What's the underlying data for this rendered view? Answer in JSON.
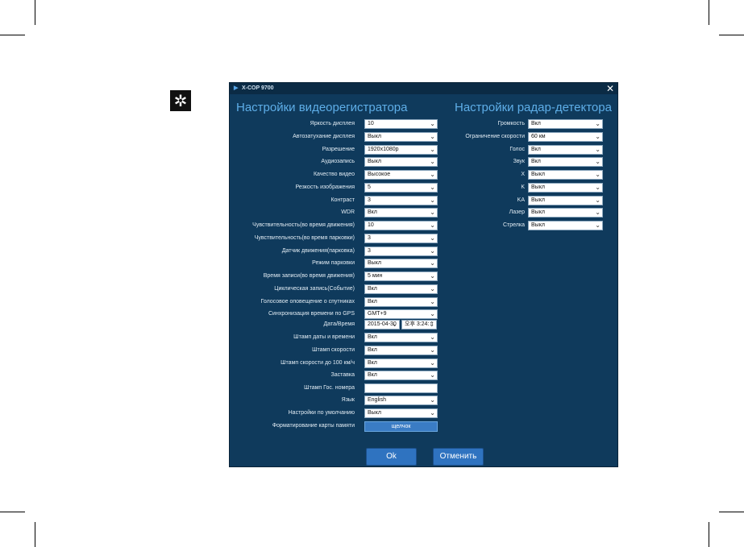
{
  "window": {
    "title": "X-COP 9700"
  },
  "video_section": {
    "heading": "Настройки видеорегистратора",
    "rows": [
      {
        "label": "Яркость дисплея",
        "value": "10"
      },
      {
        "label": "Автозатухание дисплея",
        "value": "Выкл"
      },
      {
        "label": "Разрешение",
        "value": "1920x1080p"
      },
      {
        "label": "Аудиозапись",
        "value": "Выкл"
      },
      {
        "label": "Качество видео",
        "value": "Высокое"
      },
      {
        "label": "Резкость изображения",
        "value": "5"
      },
      {
        "label": "Контраст",
        "value": "3"
      },
      {
        "label": "WDR",
        "value": "Вкл"
      },
      {
        "label": "Чувствительность(во время движения)",
        "value": "10"
      },
      {
        "label": "Чувствительность(во время парковки)",
        "value": "3"
      },
      {
        "label": "Датчик движения(парковка)",
        "value": "3"
      },
      {
        "label": "Режим парковки",
        "value": "Выкл"
      },
      {
        "label": "Время записи(во время движения)",
        "value": "5 мин"
      },
      {
        "label": "Циклическая запись(Событие)",
        "value": "Вкл"
      },
      {
        "label": "Голосовое оповещение о спутниках",
        "value": "Вкл"
      },
      {
        "label": "Синхронизация времени по GPS",
        "value": "GMT+9"
      }
    ],
    "datetime": {
      "label": "Дата/Время",
      "date": "2015-04-30",
      "time": "오후 3:24:"
    },
    "rows2": [
      {
        "label": "Штамп даты и времени",
        "value": "Вкл"
      },
      {
        "label": "Штамп скорости",
        "value": "Вкл"
      },
      {
        "label": "Штамп скорости до 100 км/ч",
        "value": "Вкл"
      },
      {
        "label": "Заставка",
        "value": "Вкл"
      }
    ],
    "plate": {
      "label": "Штамп Гос. номера",
      "value": ""
    },
    "rows3": [
      {
        "label": "Язык",
        "value": "English"
      },
      {
        "label": "Настройки по умолчанию",
        "value": "Выкл"
      }
    ],
    "format": {
      "label": "Форматирование карты памяти",
      "button": "щелчок"
    }
  },
  "radar_section": {
    "heading": "Настройки радар-детектора",
    "rows": [
      {
        "label": "Громкость",
        "value": "Вкл"
      },
      {
        "label": "Ограничение скорости",
        "value": "60 км"
      },
      {
        "label": "Голос",
        "value": "Вкл"
      },
      {
        "label": "Звук",
        "value": "Вкл"
      },
      {
        "label": "X",
        "value": "Выкл"
      },
      {
        "label": "K",
        "value": "Выкл"
      },
      {
        "label": "KA",
        "value": "Выкл"
      },
      {
        "label": "Лазер",
        "value": "Выкл"
      },
      {
        "label": "Стрелка",
        "value": "Выкл"
      }
    ]
  },
  "buttons": {
    "ok": "Ok",
    "cancel": "Отменить"
  },
  "icons": {
    "settings": "gear-icon",
    "close": "close-icon",
    "dropdown": "chevron-down-icon"
  },
  "colors": {
    "window_bg": "#0f3a5c",
    "heading": "#5eaee8",
    "button": "#2f73c0"
  }
}
